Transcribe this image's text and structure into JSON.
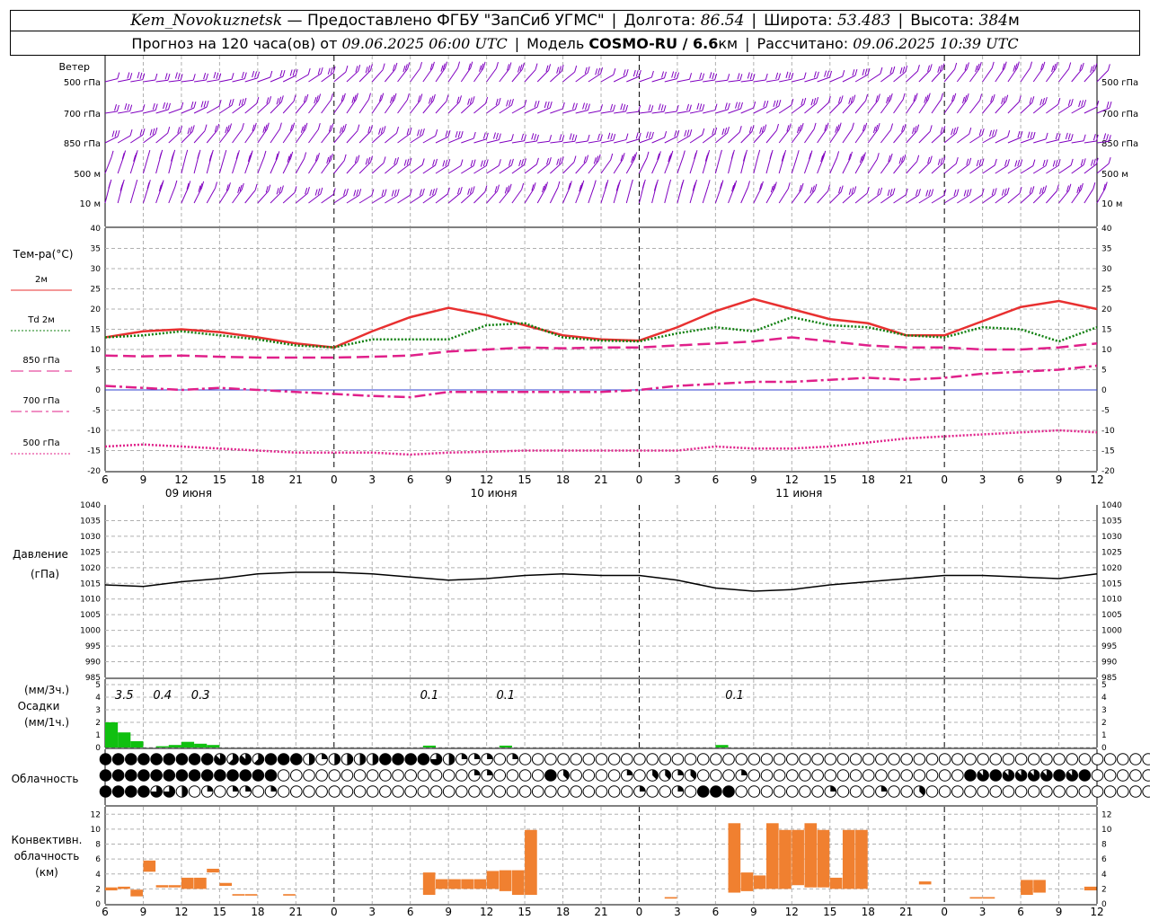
{
  "header": {
    "station": "Kem_Novokuznetsk",
    "provider": "— Предоставлено ФГБУ \"ЗапСиб УГМС\"",
    "lon_label": "Долгота:",
    "lon": "86.54",
    "lat_label": "Широта:",
    "lat": "53.483",
    "alt_label": "Высота:",
    "alt": "384",
    "alt_unit": "м",
    "forecast_label": "Прогноз на 120 часа(ов) от",
    "forecast_from": "09.06.2025 06:00 UTC",
    "model_label": "Модель",
    "model": "COSMO-RU / 6.6",
    "model_unit": "км",
    "computed_label": "Рассчитано:",
    "computed": "09.06.2025 10:39 UTC"
  },
  "labels": {
    "wind": "Ветер",
    "temp": "Тем-ра(°C)",
    "pressure_1": "Давление",
    "pressure_2": "(гПа)",
    "precip_1": "(мм/3ч.)",
    "precip_2": "Осадки",
    "precip_3": "(мм/1ч.)",
    "clouds": "Облачность",
    "conv_1": "Конвективн.",
    "conv_2": "облачность",
    "conv_3": "(км)"
  },
  "chart_data": [
    {
      "type": "wind-barbs",
      "levels": [
        "500 гПа",
        "700 гПа",
        "850 гПа",
        "500 м",
        "10 м"
      ],
      "colors": {
        "barbs": "#8000c0"
      }
    },
    {
      "type": "line",
      "x_ticks": [
        "6",
        "9",
        "12",
        "15",
        "18",
        "21",
        "0",
        "3",
        "6",
        "9",
        "12",
        "15",
        "18",
        "21",
        "0",
        "3",
        "6",
        "9",
        "12",
        "15",
        "18",
        "21",
        "0",
        "3",
        "6",
        "9",
        "12"
      ],
      "day_labels": [
        "09 июня",
        "10 июня",
        "11 июня"
      ],
      "ylim": [
        -20,
        40
      ],
      "yticks": [
        -20,
        -15,
        -10,
        -5,
        0,
        5,
        10,
        15,
        20,
        25,
        30,
        35,
        40
      ],
      "x_hours": [
        6,
        9,
        12,
        15,
        18,
        21,
        24,
        27,
        30,
        33,
        36,
        39,
        42,
        45,
        48,
        51,
        54,
        57,
        60,
        63,
        66,
        69,
        72,
        75,
        78,
        81,
        84
      ],
      "series": [
        {
          "name": "2м",
          "color": "#e83030",
          "style": "solid",
          "values": [
            13,
            14.5,
            15,
            14.3,
            13,
            11.5,
            10.5,
            14.5,
            18,
            20.3,
            18.5,
            16,
            13.5,
            12.5,
            12.2,
            15.5,
            19.5,
            22.5,
            20,
            17.5,
            16.5,
            13.5,
            13.5,
            17,
            20.5,
            22,
            20
          ]
        },
        {
          "name": "Td 2м",
          "color": "#108010",
          "style": "dotted",
          "values": [
            13,
            13.5,
            14.5,
            13.5,
            12.5,
            11,
            10.5,
            12.5,
            12.5,
            12.5,
            16,
            16.5,
            13,
            12.2,
            12,
            14,
            15.5,
            14.5,
            18,
            16,
            15.5,
            13.5,
            13,
            15.5,
            15,
            12,
            15.5
          ]
        },
        {
          "name": "850 гПа",
          "color": "#e0208a",
          "style": "long-dash",
          "values": [
            8.5,
            8.3,
            8.5,
            8.2,
            8,
            8,
            8,
            8.2,
            8.5,
            9.5,
            10,
            10.5,
            10.3,
            10.5,
            10.5,
            11,
            11.5,
            12,
            13,
            12,
            11,
            10.5,
            10.5,
            10,
            10,
            10.5,
            11.5
          ]
        },
        {
          "name": "700 гПа",
          "color": "#e0208a",
          "style": "dash-dot",
          "values": [
            1,
            0.5,
            0,
            0.5,
            0,
            -0.5,
            -1,
            -1.5,
            -1.8,
            -0.5,
            -0.5,
            -0.5,
            -0.5,
            -0.5,
            0,
            1,
            1.5,
            2,
            2,
            2.5,
            3,
            2.5,
            3,
            4,
            4.5,
            5,
            6
          ]
        },
        {
          "name": "500 гПа",
          "color": "#e0208a",
          "style": "dotted",
          "values": [
            -14,
            -13.5,
            -14,
            -14.5,
            -15,
            -15.5,
            -15.5,
            -15.5,
            -16,
            -15.5,
            -15.3,
            -15,
            -15,
            -15,
            -15,
            -15,
            -14,
            -14.5,
            -14.5,
            -14,
            -13,
            -12,
            -11.5,
            -11,
            -10.5,
            -10,
            -10.5
          ]
        }
      ]
    },
    {
      "type": "line",
      "ylim": [
        985,
        1040
      ],
      "yticks": [
        985,
        990,
        995,
        1000,
        1005,
        1010,
        1015,
        1020,
        1025,
        1030,
        1035,
        1040
      ],
      "series": [
        {
          "color": "#000000",
          "x_hours": [
            6,
            9,
            12,
            15,
            18,
            21,
            24,
            27,
            30,
            33,
            36,
            39,
            42,
            45,
            48,
            51,
            54,
            57,
            60,
            63,
            66,
            69,
            72,
            75,
            78,
            81,
            84
          ],
          "values": [
            1014.5,
            1014,
            1015.5,
            1016.5,
            1018,
            1018.5,
            1018.5,
            1018,
            1017,
            1016,
            1016.5,
            1017.5,
            1018,
            1017.5,
            1017.5,
            1016,
            1013.5,
            1012.5,
            1013,
            1014.5,
            1015.5,
            1016.5,
            1017.5,
            1017.5,
            1017,
            1016.5,
            1018
          ]
        }
      ]
    },
    {
      "type": "bar",
      "ylim": [
        0,
        5
      ],
      "yticks": [
        0,
        1,
        2,
        3,
        4,
        5
      ],
      "values_3h": [
        {
          "x_hour": 7.5,
          "label": "3.5"
        },
        {
          "x_hour": 10.5,
          "label": "0.4"
        },
        {
          "x_hour": 13.5,
          "label": "0.3"
        },
        {
          "x_hour": 31.5,
          "label": "0.1"
        },
        {
          "x_hour": 37.5,
          "label": "0.1"
        },
        {
          "x_hour": 55.5,
          "label": "0.1"
        }
      ],
      "bars_1h": [
        {
          "x": 6,
          "v": 2
        },
        {
          "x": 7,
          "v": 1.2
        },
        {
          "x": 8,
          "v": 0.5
        },
        {
          "x": 10,
          "v": 0.1
        },
        {
          "x": 11,
          "v": 0.2
        },
        {
          "x": 12,
          "v": 0.45
        },
        {
          "x": 13,
          "v": 0.3
        },
        {
          "x": 14,
          "v": 0.2
        },
        {
          "x": 31,
          "v": 0.15
        },
        {
          "x": 37,
          "v": 0.15
        },
        {
          "x": 54,
          "v": 0.2
        }
      ],
      "color": "#10c010"
    },
    {
      "type": "table",
      "rows": 3,
      "step_hours": 1,
      "start_hour": 6,
      "cover": [
        [
          8,
          8,
          8,
          8,
          8,
          8,
          8,
          8,
          8,
          7,
          5,
          7,
          5,
          8,
          8,
          8,
          4,
          2,
          4,
          4,
          4,
          4,
          8,
          8,
          8,
          8,
          6,
          4,
          2,
          2,
          2,
          0,
          2,
          0,
          0,
          0,
          0,
          0,
          0,
          0,
          0,
          0,
          0,
          0,
          0,
          0,
          0,
          0,
          0,
          0,
          0,
          0,
          0,
          0,
          0,
          0,
          0,
          0,
          0,
          0,
          0,
          0,
          0,
          0,
          0,
          0,
          0,
          0,
          0,
          0,
          0,
          0,
          0,
          0,
          0,
          0,
          0,
          0,
          0,
          0,
          0,
          0,
          0,
          0,
          0
        ],
        [
          8,
          8,
          8,
          8,
          8,
          8,
          8,
          8,
          8,
          8,
          8,
          8,
          8,
          8,
          0,
          0,
          0,
          0,
          0,
          0,
          0,
          0,
          0,
          0,
          0,
          0,
          0,
          0,
          0,
          2,
          2,
          0,
          0,
          0,
          0,
          8,
          3,
          0,
          0,
          0,
          0,
          2,
          0,
          3,
          3,
          2,
          3,
          0,
          0,
          0,
          2,
          0,
          0,
          0,
          0,
          0,
          0,
          0,
          0,
          0,
          0,
          0,
          0,
          0,
          0,
          0,
          0,
          0,
          8,
          7,
          8,
          7,
          7,
          7,
          7,
          8,
          7,
          8,
          0,
          0,
          0,
          0,
          0,
          0,
          0
        ],
        [
          8,
          8,
          8,
          8,
          6,
          6,
          4,
          0,
          2,
          0,
          2,
          2,
          0,
          2,
          0,
          0,
          0,
          0,
          0,
          0,
          0,
          0,
          0,
          0,
          0,
          0,
          0,
          0,
          0,
          0,
          0,
          0,
          0,
          0,
          0,
          0,
          0,
          0,
          0,
          0,
          0,
          0,
          2,
          0,
          0,
          2,
          0,
          8,
          8,
          8,
          0,
          0,
          0,
          0,
          0,
          0,
          0,
          2,
          0,
          0,
          0,
          2,
          0,
          0,
          3,
          0,
          0,
          0,
          0,
          0,
          0,
          0,
          0,
          0,
          0,
          0,
          0,
          0,
          0,
          0,
          0,
          0,
          0,
          0,
          0
        ]
      ]
    },
    {
      "type": "bar",
      "ylim": [
        0,
        13
      ],
      "yticks": [
        0,
        2,
        4,
        6,
        8,
        10,
        12
      ],
      "color": "#f08030",
      "bars": [
        {
          "x0": 6,
          "x1": 7,
          "b": 1.8,
          "t": 2.2
        },
        {
          "x0": 7,
          "x1": 8,
          "b": 2,
          "t": 2.3
        },
        {
          "x0": 8,
          "x1": 9,
          "b": 1,
          "t": 1.9
        },
        {
          "x0": 9,
          "x1": 10,
          "b": 4.3,
          "t": 5.8
        },
        {
          "x0": 10,
          "x1": 11,
          "b": 2.2,
          "t": 2.5
        },
        {
          "x0": 11,
          "x1": 12,
          "b": 2.2,
          "t": 2.5
        },
        {
          "x0": 12,
          "x1": 13,
          "b": 2,
          "t": 3.5
        },
        {
          "x0": 13,
          "x1": 14,
          "b": 2,
          "t": 3.5
        },
        {
          "x0": 14,
          "x1": 15,
          "b": 4.2,
          "t": 4.7
        },
        {
          "x0": 15,
          "x1": 16,
          "b": 2.4,
          "t": 2.8
        },
        {
          "x0": 16,
          "x1": 17,
          "b": 1.1,
          "t": 1.3
        },
        {
          "x0": 17,
          "x1": 18,
          "b": 1.1,
          "t": 1.3
        },
        {
          "x0": 20,
          "x1": 21,
          "b": 1.1,
          "t": 1.3
        },
        {
          "x0": 31,
          "x1": 32,
          "b": 1.2,
          "t": 4.2
        },
        {
          "x0": 32,
          "x1": 33,
          "b": 2,
          "t": 3.3
        },
        {
          "x0": 33,
          "x1": 34,
          "b": 2,
          "t": 3.3
        },
        {
          "x0": 34,
          "x1": 35,
          "b": 2,
          "t": 3.3
        },
        {
          "x0": 35,
          "x1": 36,
          "b": 2,
          "t": 3.3
        },
        {
          "x0": 36,
          "x1": 37,
          "b": 2,
          "t": 4.4
        },
        {
          "x0": 37,
          "x1": 38,
          "b": 1.7,
          "t": 4.5
        },
        {
          "x0": 38,
          "x1": 39,
          "b": 1.2,
          "t": 4.5
        },
        {
          "x0": 39,
          "x1": 40,
          "b": 1.2,
          "t": 9.9
        },
        {
          "x0": 50,
          "x1": 51,
          "b": 0.7,
          "t": 0.9
        },
        {
          "x0": 55,
          "x1": 56,
          "b": 1.5,
          "t": 10.8
        },
        {
          "x0": 56,
          "x1": 57,
          "b": 1.7,
          "t": 4.2
        },
        {
          "x0": 57,
          "x1": 58,
          "b": 2,
          "t": 3.8
        },
        {
          "x0": 58,
          "x1": 59,
          "b": 2,
          "t": 10.8
        },
        {
          "x0": 59,
          "x1": 60,
          "b": 2,
          "t": 9.9
        },
        {
          "x0": 60,
          "x1": 61,
          "b": 2.5,
          "t": 9.9
        },
        {
          "x0": 61,
          "x1": 62,
          "b": 2.2,
          "t": 10.8
        },
        {
          "x0": 62,
          "x1": 63,
          "b": 2.2,
          "t": 9.9
        },
        {
          "x0": 63,
          "x1": 64,
          "b": 2,
          "t": 3.5
        },
        {
          "x0": 64,
          "x1": 65,
          "b": 2,
          "t": 9.9
        },
        {
          "x0": 65,
          "x1": 66,
          "b": 2,
          "t": 9.9
        },
        {
          "x0": 70,
          "x1": 71,
          "b": 2.6,
          "t": 3
        },
        {
          "x0": 74,
          "x1": 75,
          "b": 0.7,
          "t": 0.9
        },
        {
          "x0": 75,
          "x1": 76,
          "b": 0.7,
          "t": 0.9
        },
        {
          "x0": 78,
          "x1": 79,
          "b": 1.2,
          "t": 3.2
        },
        {
          "x0": 79,
          "x1": 80,
          "b": 1.5,
          "t": 3.2
        },
        {
          "x0": 83,
          "x1": 84,
          "b": 1.8,
          "t": 2.3
        }
      ]
    }
  ]
}
